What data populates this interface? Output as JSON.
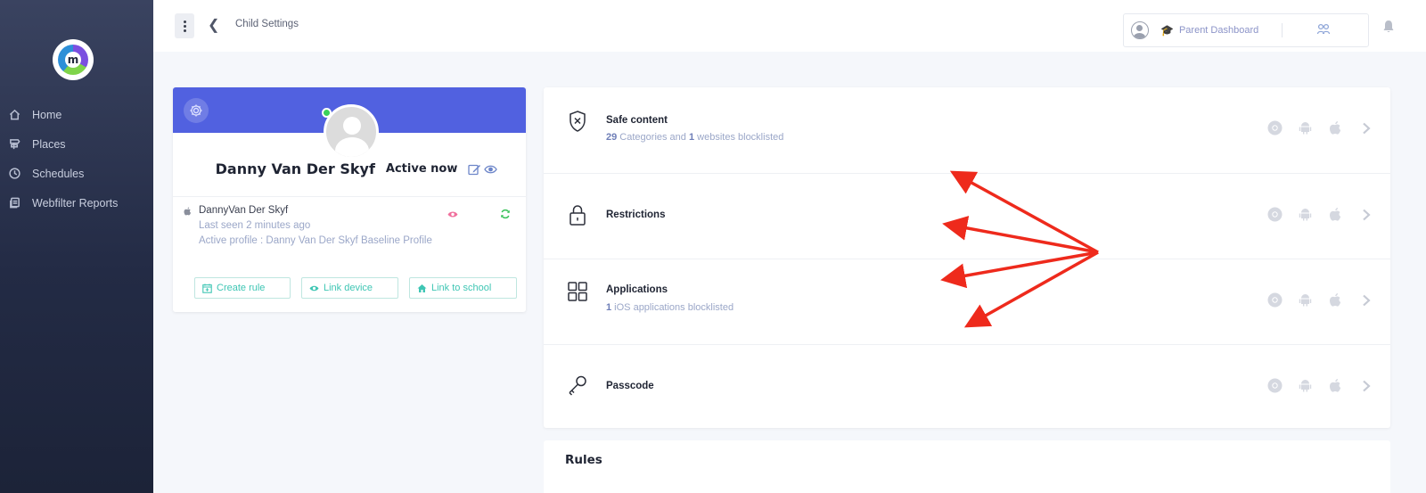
{
  "sidebar": {
    "logo_letter": "m",
    "items": [
      {
        "label": "Home",
        "icon": "home-icon"
      },
      {
        "label": "Places",
        "icon": "places-icon"
      },
      {
        "label": "Schedules",
        "icon": "clock-icon"
      },
      {
        "label": "Webfilter Reports",
        "icon": "report-icon"
      }
    ]
  },
  "header": {
    "breadcrumb": "Child Settings",
    "parent_dashboard_label": "Parent Dashboard"
  },
  "profile": {
    "name": "Danny Van Der Skyf",
    "status": "Active now",
    "device": {
      "name": "DannyVan Der Skyf",
      "last_seen": "Last seen 2 minutes ago",
      "active_profile": "Active profile : Danny Van Der Skyf Baseline Profile"
    },
    "actions": {
      "create_rule": "Create rule",
      "link_device": "Link device",
      "link_school": "Link to school"
    }
  },
  "settings": [
    {
      "title": "Safe content",
      "sub_count1": "29",
      "sub_text1": " Categories and ",
      "sub_count2": "1",
      "sub_text2": " websites blocklisted",
      "icon": "shield-x-icon"
    },
    {
      "title": "Restrictions",
      "icon": "lock-icon"
    },
    {
      "title": "Applications",
      "sub_count1": "1",
      "sub_text1": " iOS applications blocklisted",
      "icon": "apps-grid-icon"
    },
    {
      "title": "Passcode",
      "icon": "key-icon"
    }
  ],
  "rules": {
    "title": "Rules"
  },
  "colors": {
    "sidebar": "#2a3250",
    "profile_header": "#5161e0",
    "accent_teal": "#3fc6b4",
    "online": "#3bd15b",
    "annotation_arrow": "#ee2a1c"
  }
}
